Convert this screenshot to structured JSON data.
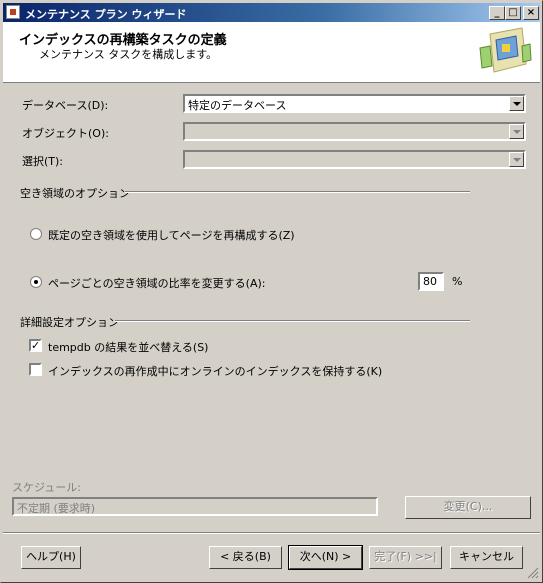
{
  "window": {
    "title": "メンテナンス プラン ウィザード"
  },
  "header": {
    "title": "インデックスの再構築タスクの定義",
    "subtitle": "メンテナンス タスクを構成します。"
  },
  "fields": {
    "database_label": "データベース(D):",
    "database_value": "特定のデータベース",
    "object_label": "オブジェクト(O):",
    "selection_label": "選択(T):"
  },
  "free_space": {
    "group_label": "空き領域のオプション",
    "option1_label": "既定の空き領域を使用してページを再構成する(Z)",
    "option2_label": "ページごとの空き領域の比率を変更する(A):",
    "percent_value": "80",
    "percent_unit": "%"
  },
  "advanced": {
    "group_label": "詳細設定オプション",
    "sort_tempdb_label": "tempdb の結果を並べ替える(S)",
    "keep_online_label": "インデックスの再作成中にオンラインのインデックスを保持する(K)"
  },
  "schedule": {
    "label": "スケジュール:",
    "value": "不定期 (要求時)",
    "change_button": "変更(C)..."
  },
  "footer": {
    "help": "ヘルプ(H)",
    "back": "< 戻る(B)",
    "next": "次へ(N) >",
    "finish": "完了(F) >>|",
    "cancel": "キャンセル"
  },
  "state": {
    "option2_selected": true,
    "sort_tempdb_checked": true,
    "keep_online_checked": false
  }
}
